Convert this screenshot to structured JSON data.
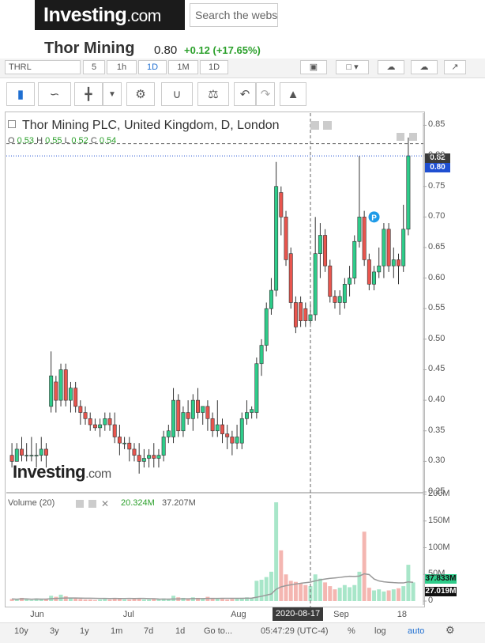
{
  "header": {
    "logo": "Investing.com",
    "search_placeholder": "Search the webs",
    "instrument_name": "Thor Mining",
    "price": "0.80",
    "change": "+0.12 (+17.65%)"
  },
  "toolbar1": {
    "symbol": "THRL",
    "intervals": [
      "5",
      "1h",
      "1D",
      "1M",
      "1D"
    ],
    "icons": [
      "camera-icon",
      "chart-style-dropdown",
      "cloud-download-icon",
      "cloud-upload-icon",
      "fullscreen-icon"
    ]
  },
  "toolbar2": {
    "icons": [
      "candlestick-icon",
      "line-chart-icon",
      "bar-chart-icon",
      "dropdown-icon",
      "gear-icon",
      "indicators-icon",
      "compare-icon",
      "undo-icon",
      "redo-icon",
      "alert-icon"
    ]
  },
  "legend": {
    "title": "Thor Mining PLC, United Kingdom, D, London",
    "ohlc": "O 0.53  H 0.55  L 0.52  C 0.54",
    "o": "0.53",
    "h": "0.55",
    "l": "0.52",
    "c": "0.54"
  },
  "volume_legend": {
    "label": "Volume (20)",
    "v1": "20.324M",
    "v2": "37.207M"
  },
  "crosshair": {
    "date": "2020-08-17",
    "price_label": "0.82"
  },
  "last_price_label": "0.80",
  "volume_tags": {
    "v1": "37.833M",
    "v2": "27.019M"
  },
  "bottom_bar": {
    "ranges": [
      "10y",
      "3y",
      "1y",
      "1m",
      "7d",
      "1d",
      "Go to..."
    ],
    "time": "05:47:29 (UTC-4)",
    "options": [
      "%",
      "log",
      "auto"
    ]
  },
  "watermark": "Investing.com",
  "colors": {
    "up": "#2ecc8a",
    "down": "#e8554e",
    "vol_up": "#a8e6c9",
    "vol_down": "#f4b6b1",
    "ma": "#999999",
    "last_price": "#1f4fd1"
  },
  "chart_data": {
    "type": "candlestick",
    "ylim": [
      0.25,
      0.87
    ],
    "yticks": [
      "0.85",
      "0.80",
      "0.75",
      "0.70",
      "0.65",
      "0.60",
      "0.55",
      "0.50",
      "0.45",
      "0.40",
      "0.35",
      "0.30",
      "0.25"
    ],
    "x_labels": [
      "Jun",
      "Jul",
      "Aug",
      "Sep",
      "18"
    ],
    "volume_yticks": [
      "200M",
      "150M",
      "100M",
      "50M",
      "0"
    ],
    "volume_ylim": [
      0,
      200
    ],
    "candles": [
      {
        "o": 0.31,
        "h": 0.33,
        "l": 0.29,
        "c": 0.3
      },
      {
        "o": 0.3,
        "h": 0.33,
        "l": 0.3,
        "c": 0.32
      },
      {
        "o": 0.32,
        "h": 0.34,
        "l": 0.3,
        "c": 0.31
      },
      {
        "o": 0.31,
        "h": 0.33,
        "l": 0.3,
        "c": 0.31
      },
      {
        "o": 0.31,
        "h": 0.34,
        "l": 0.3,
        "c": 0.31
      },
      {
        "o": 0.31,
        "h": 0.33,
        "l": 0.29,
        "c": 0.31
      },
      {
        "o": 0.31,
        "h": 0.34,
        "l": 0.3,
        "c": 0.32
      },
      {
        "o": 0.32,
        "h": 0.33,
        "l": 0.29,
        "c": 0.31
      },
      {
        "o": 0.39,
        "h": 0.48,
        "l": 0.38,
        "c": 0.44
      },
      {
        "o": 0.43,
        "h": 0.44,
        "l": 0.38,
        "c": 0.4
      },
      {
        "o": 0.4,
        "h": 0.46,
        "l": 0.39,
        "c": 0.45
      },
      {
        "o": 0.45,
        "h": 0.46,
        "l": 0.39,
        "c": 0.4
      },
      {
        "o": 0.4,
        "h": 0.43,
        "l": 0.38,
        "c": 0.42
      },
      {
        "o": 0.42,
        "h": 0.43,
        "l": 0.38,
        "c": 0.39
      },
      {
        "o": 0.39,
        "h": 0.4,
        "l": 0.36,
        "c": 0.38
      },
      {
        "o": 0.38,
        "h": 0.39,
        "l": 0.36,
        "c": 0.37
      },
      {
        "o": 0.37,
        "h": 0.38,
        "l": 0.35,
        "c": 0.36
      },
      {
        "o": 0.36,
        "h": 0.37,
        "l": 0.35,
        "c": 0.355
      },
      {
        "o": 0.355,
        "h": 0.37,
        "l": 0.34,
        "c": 0.36
      },
      {
        "o": 0.36,
        "h": 0.38,
        "l": 0.35,
        "c": 0.37
      },
      {
        "o": 0.37,
        "h": 0.38,
        "l": 0.35,
        "c": 0.36
      },
      {
        "o": 0.36,
        "h": 0.38,
        "l": 0.33,
        "c": 0.34
      },
      {
        "o": 0.34,
        "h": 0.36,
        "l": 0.31,
        "c": 0.33
      },
      {
        "o": 0.33,
        "h": 0.34,
        "l": 0.32,
        "c": 0.33
      },
      {
        "o": 0.33,
        "h": 0.34,
        "l": 0.3,
        "c": 0.32
      },
      {
        "o": 0.32,
        "h": 0.33,
        "l": 0.3,
        "c": 0.31
      },
      {
        "o": 0.31,
        "h": 0.33,
        "l": 0.28,
        "c": 0.3
      },
      {
        "o": 0.3,
        "h": 0.32,
        "l": 0.29,
        "c": 0.305
      },
      {
        "o": 0.305,
        "h": 0.32,
        "l": 0.29,
        "c": 0.31
      },
      {
        "o": 0.31,
        "h": 0.33,
        "l": 0.29,
        "c": 0.305
      },
      {
        "o": 0.305,
        "h": 0.32,
        "l": 0.29,
        "c": 0.31
      },
      {
        "o": 0.31,
        "h": 0.35,
        "l": 0.3,
        "c": 0.34
      },
      {
        "o": 0.34,
        "h": 0.36,
        "l": 0.33,
        "c": 0.35
      },
      {
        "o": 0.34,
        "h": 0.42,
        "l": 0.33,
        "c": 0.4
      },
      {
        "o": 0.4,
        "h": 0.41,
        "l": 0.34,
        "c": 0.35
      },
      {
        "o": 0.35,
        "h": 0.39,
        "l": 0.34,
        "c": 0.38
      },
      {
        "o": 0.38,
        "h": 0.4,
        "l": 0.36,
        "c": 0.37
      },
      {
        "o": 0.37,
        "h": 0.41,
        "l": 0.35,
        "c": 0.4
      },
      {
        "o": 0.4,
        "h": 0.42,
        "l": 0.37,
        "c": 0.38
      },
      {
        "o": 0.38,
        "h": 0.39,
        "l": 0.36,
        "c": 0.39
      },
      {
        "o": 0.39,
        "h": 0.4,
        "l": 0.35,
        "c": 0.37
      },
      {
        "o": 0.37,
        "h": 0.38,
        "l": 0.34,
        "c": 0.35
      },
      {
        "o": 0.35,
        "h": 0.4,
        "l": 0.34,
        "c": 0.36
      },
      {
        "o": 0.36,
        "h": 0.37,
        "l": 0.33,
        "c": 0.345
      },
      {
        "o": 0.345,
        "h": 0.36,
        "l": 0.32,
        "c": 0.34
      },
      {
        "o": 0.34,
        "h": 0.35,
        "l": 0.31,
        "c": 0.33
      },
      {
        "o": 0.33,
        "h": 0.36,
        "l": 0.32,
        "c": 0.34
      },
      {
        "o": 0.33,
        "h": 0.38,
        "l": 0.32,
        "c": 0.37
      },
      {
        "o": 0.37,
        "h": 0.4,
        "l": 0.36,
        "c": 0.38
      },
      {
        "o": 0.38,
        "h": 0.39,
        "l": 0.37,
        "c": 0.385
      },
      {
        "o": 0.38,
        "h": 0.47,
        "l": 0.37,
        "c": 0.46
      },
      {
        "o": 0.46,
        "h": 0.5,
        "l": 0.44,
        "c": 0.49
      },
      {
        "o": 0.49,
        "h": 0.56,
        "l": 0.48,
        "c": 0.55
      },
      {
        "o": 0.55,
        "h": 0.6,
        "l": 0.54,
        "c": 0.58
      },
      {
        "o": 0.58,
        "h": 0.79,
        "l": 0.57,
        "c": 0.75
      },
      {
        "o": 0.74,
        "h": 0.75,
        "l": 0.67,
        "c": 0.7
      },
      {
        "o": 0.7,
        "h": 0.71,
        "l": 0.62,
        "c": 0.63
      },
      {
        "o": 0.64,
        "h": 0.65,
        "l": 0.55,
        "c": 0.56
      },
      {
        "o": 0.56,
        "h": 0.57,
        "l": 0.51,
        "c": 0.52
      },
      {
        "o": 0.56,
        "h": 0.57,
        "l": 0.52,
        "c": 0.53
      },
      {
        "o": 0.55,
        "h": 0.56,
        "l": 0.52,
        "c": 0.53
      },
      {
        "o": 0.53,
        "h": 0.56,
        "l": 0.52,
        "c": 0.54
      },
      {
        "o": 0.54,
        "h": 0.7,
        "l": 0.53,
        "c": 0.64
      },
      {
        "o": 0.64,
        "h": 0.69,
        "l": 0.6,
        "c": 0.67
      },
      {
        "o": 0.67,
        "h": 0.68,
        "l": 0.61,
        "c": 0.62
      },
      {
        "o": 0.62,
        "h": 0.63,
        "l": 0.56,
        "c": 0.57
      },
      {
        "o": 0.57,
        "h": 0.58,
        "l": 0.55,
        "c": 0.56
      },
      {
        "o": 0.56,
        "h": 0.58,
        "l": 0.54,
        "c": 0.57
      },
      {
        "o": 0.56,
        "h": 0.6,
        "l": 0.55,
        "c": 0.59
      },
      {
        "o": 0.59,
        "h": 0.62,
        "l": 0.57,
        "c": 0.6
      },
      {
        "o": 0.6,
        "h": 0.67,
        "l": 0.59,
        "c": 0.66
      },
      {
        "o": 0.66,
        "h": 0.8,
        "l": 0.65,
        "c": 0.7
      },
      {
        "o": 0.7,
        "h": 0.71,
        "l": 0.62,
        "c": 0.63
      },
      {
        "o": 0.63,
        "h": 0.64,
        "l": 0.58,
        "c": 0.59
      },
      {
        "o": 0.59,
        "h": 0.62,
        "l": 0.58,
        "c": 0.61
      },
      {
        "o": 0.61,
        "h": 0.65,
        "l": 0.6,
        "c": 0.62
      },
      {
        "o": 0.62,
        "h": 0.69,
        "l": 0.6,
        "c": 0.68
      },
      {
        "o": 0.68,
        "h": 0.69,
        "l": 0.61,
        "c": 0.62
      },
      {
        "o": 0.62,
        "h": 0.65,
        "l": 0.6,
        "c": 0.63
      },
      {
        "o": 0.63,
        "h": 0.64,
        "l": 0.59,
        "c": 0.62
      },
      {
        "o": 0.62,
        "h": 0.72,
        "l": 0.61,
        "c": 0.68
      },
      {
        "o": 0.68,
        "h": 0.83,
        "l": 0.67,
        "c": 0.8
      }
    ],
    "volume": [
      4,
      3,
      6,
      3,
      2,
      5,
      3,
      4,
      10,
      8,
      12,
      9,
      6,
      5,
      4,
      3,
      3,
      2,
      3,
      4,
      3,
      5,
      4,
      3,
      3,
      4,
      5,
      3,
      3,
      4,
      3,
      5,
      4,
      10,
      7,
      6,
      5,
      7,
      6,
      4,
      8,
      6,
      5,
      4,
      3,
      4,
      5,
      6,
      7,
      5,
      38,
      40,
      45,
      55,
      185,
      95,
      50,
      38,
      36,
      33,
      30,
      28,
      50,
      42,
      35,
      28,
      22,
      25,
      30,
      26,
      30,
      55,
      130,
      25,
      20,
      22,
      18,
      20,
      22,
      24,
      28,
      68,
      35
    ]
  }
}
